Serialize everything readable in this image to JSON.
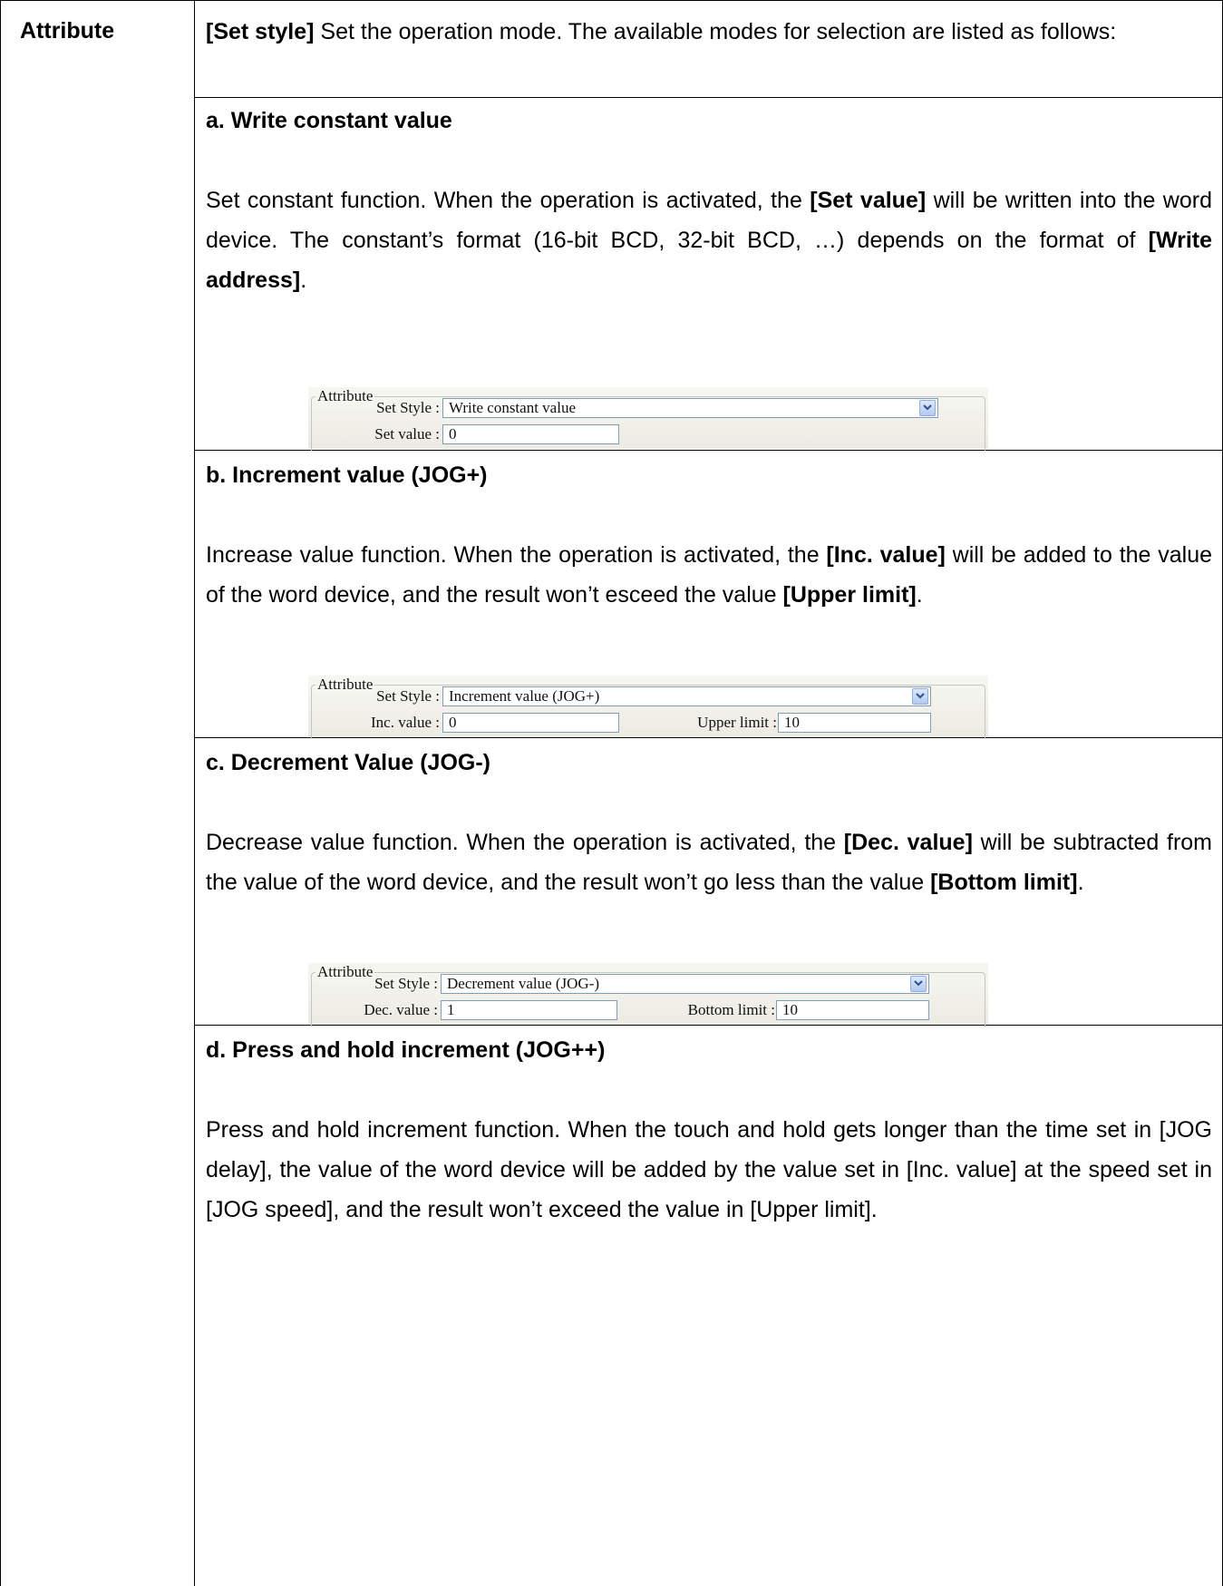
{
  "row_label": "Attribute",
  "intro": {
    "bold": "[Set style]",
    "text": " Set the operation mode. The available modes for selection are listed as follows:"
  },
  "sections": [
    {
      "heading": "a. Write constant value",
      "desc": [
        {
          "t": "Set constant function. When the operation is activated, the "
        },
        {
          "t": "[Set value]",
          "b": true
        },
        {
          "t": " will be written into the word device. The constant’s format (16-bit BCD, 32-bit BCD, …) depends on the format of "
        },
        {
          "t": "[Write address]",
          "b": true
        },
        {
          "t": "."
        }
      ],
      "panel": {
        "legend": "Attribute",
        "set_style_label": "Set Style :",
        "set_style_value": "Write constant value",
        "field1_label": "Set value :",
        "field1_value": "0"
      }
    },
    {
      "heading": "b. Increment value (JOG+)",
      "desc": [
        {
          "t": "Increase value function. When the operation is activated, the "
        },
        {
          "t": "[Inc. value]",
          "b": true
        },
        {
          "t": " will be added to the value of the word device, and the result won’t esceed the value "
        },
        {
          "t": "[Upper limit]",
          "b": true
        },
        {
          "t": "."
        }
      ],
      "panel": {
        "legend": "Attribute",
        "set_style_label": "Set Style :",
        "set_style_value": "Increment value (JOG+)",
        "field1_label": "Inc. value :",
        "field1_value": "0",
        "field2_label": "Upper limit :",
        "field2_value": "10"
      }
    },
    {
      "heading": "c. Decrement Value (JOG-)",
      "desc": [
        {
          "t": "Decrease value function. When the operation is activated, the "
        },
        {
          "t": "[Dec. value]",
          "b": true
        },
        {
          "t": " will be subtracted from the value of the word device, and the result won’t go less than the value "
        },
        {
          "t": "[Bottom limit]",
          "b": true
        },
        {
          "t": "."
        }
      ],
      "panel": {
        "legend": "Attribute",
        "set_style_label": "Set Style :",
        "set_style_value": "Decrement value (JOG-)",
        "field1_label": "Dec. value :",
        "field1_value": "1",
        "field2_label": "Bottom limit :",
        "field2_value": "10"
      }
    },
    {
      "heading": "d. Press and hold increment (JOG++)",
      "desc": [
        {
          "t": "Press and hold increment function. When the touch and hold gets longer than the time set in [JOG delay], the value of the word device will be added by the value set in [Inc. value] at the speed set in [JOG speed], and the result won’t exceed the value in [Upper limit]."
        }
      ]
    }
  ],
  "colors": {
    "border": "#000000",
    "panel_bg": "#f2f1ea",
    "field_border": "#7f9db9",
    "dropdown_button": "#b3c9ef"
  }
}
